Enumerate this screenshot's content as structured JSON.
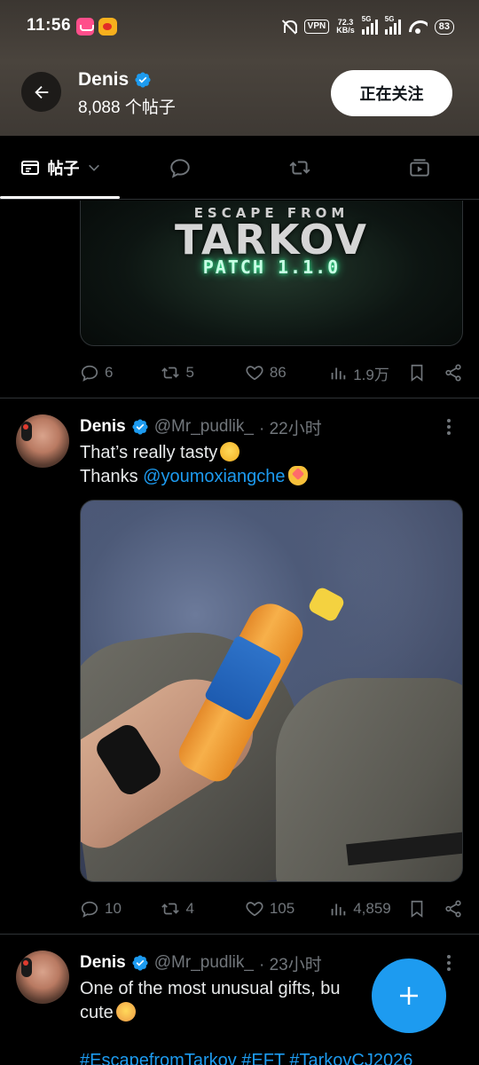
{
  "status_bar": {
    "time": "11:56",
    "vpn": "VPN",
    "speed_value": "72.3",
    "speed_unit": "KB/s",
    "signal1_label": "5G",
    "signal2_label": "5G",
    "battery": "83"
  },
  "profile": {
    "name": "Denis",
    "post_count": "8,088 个帖子",
    "follow_label": "正在关注"
  },
  "tabs": [
    {
      "label": "帖子",
      "icon": "posts-icon",
      "active": true
    },
    {
      "label": "",
      "icon": "reply-icon",
      "active": false
    },
    {
      "label": "",
      "icon": "repost-icon",
      "active": false
    },
    {
      "label": "",
      "icon": "media-icon",
      "active": false
    }
  ],
  "post1": {
    "media": {
      "title_small": "ESCAPE FROM",
      "title_big": "TARKOV",
      "patch": "PATCH 1.1.0"
    },
    "stats": {
      "replies": "6",
      "reposts": "5",
      "likes": "86",
      "views": "1.9万"
    }
  },
  "post2": {
    "author": "Denis",
    "handle": "@Mr_pudlik_",
    "time": "· 22小时",
    "line1": "That’s really tasty",
    "line2_prefix": "Thanks ",
    "mention": "@youmoxiangche",
    "stats": {
      "replies": "10",
      "reposts": "4",
      "likes": "105",
      "views": "4,859"
    }
  },
  "post3": {
    "author": "Denis",
    "handle": "@Mr_pudlik_",
    "time": "· 23小时",
    "line1": "One of the most unusual gifts, bu",
    "line2": "cute",
    "hashtags": "#EscapefromTarkov #EFT #TarkovCJ2026"
  },
  "colors": {
    "accent": "#1d9bf0",
    "background": "#000000",
    "muted": "#71767b",
    "divider": "#2f3336"
  }
}
